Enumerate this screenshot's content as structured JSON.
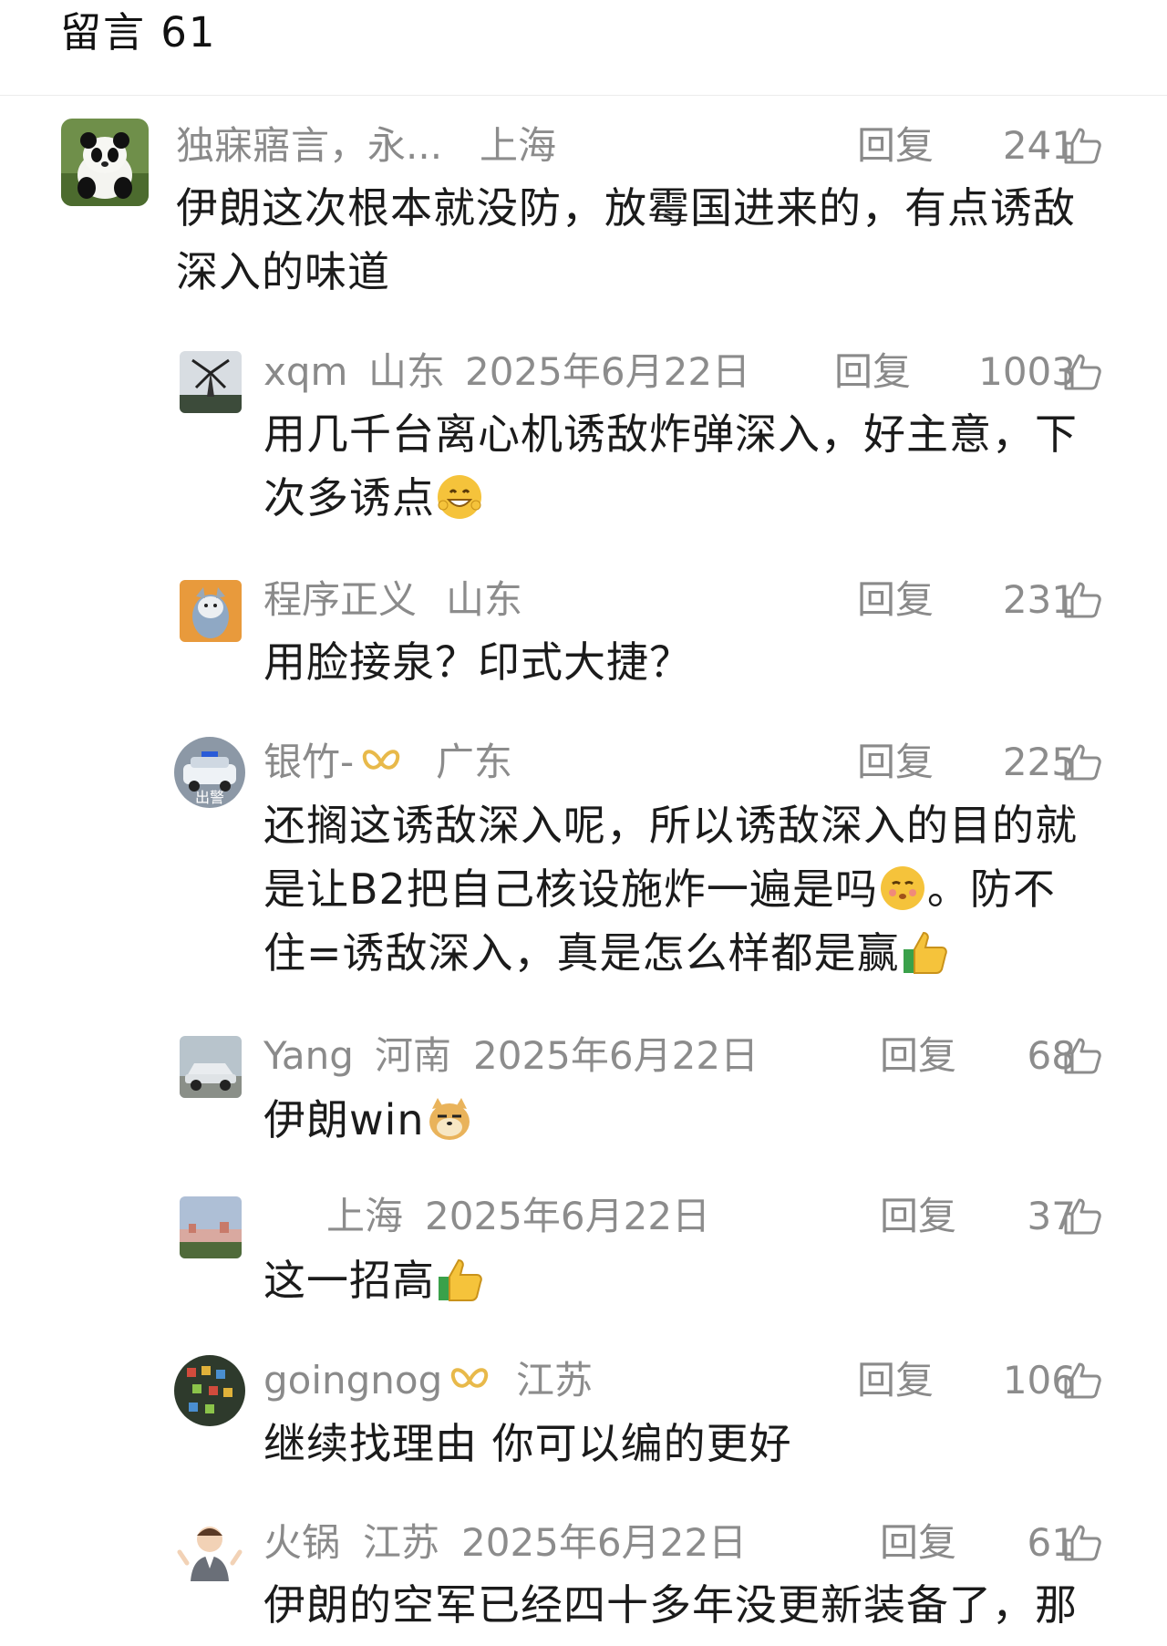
{
  "header": {
    "title": "留言 61"
  },
  "comments": [
    {
      "author": "独寐寤言，永...",
      "location": "上海",
      "date": "",
      "reply": "回复",
      "likes": "241",
      "text": [
        "伊朗这次根本就没防，放霉国进来的，有点诱敌",
        "深入的味道"
      ],
      "avatar": "panda-avatar"
    },
    {
      "author": "xqm",
      "location": "山东",
      "date": "2025年6月22日",
      "reply": "回复",
      "likes": "1003",
      "text": [
        "用几千台离心机诱敌炸弹深入，好主意，下",
        "次多诱点"
      ],
      "avatar": "windmill-avatar"
    },
    {
      "author": "程序正义",
      "location": "山东",
      "date": "",
      "reply": "回复",
      "likes": "231",
      "text": [
        "用脸接泉？印式大捷？"
      ],
      "avatar": "cartoon-avatar"
    },
    {
      "author": "银竹-",
      "location": "广东",
      "date": "",
      "reply": "回复",
      "likes": "225",
      "text": [
        "还搁这诱敌深入呢，所以诱敌深入的目的就",
        "是让B2把自己核设施炸一遍是吗",
        "住=诱敌深入，真是怎么样都是赢"
      ],
      "text_tail": "。防不",
      "avatar": "police-car-avatar",
      "avatar_label": "出警"
    },
    {
      "author": "Yang",
      "location": "河南",
      "date": "2025年6月22日",
      "reply": "回复",
      "likes": "68",
      "text": [
        "伊朗win"
      ],
      "avatar": "car-avatar"
    },
    {
      "author": "",
      "location": "上海",
      "date": "2025年6月22日",
      "reply": "回复",
      "likes": "37",
      "text": [
        "这一招高"
      ],
      "avatar": "landscape-avatar"
    },
    {
      "author": "goingnog",
      "location": "江苏",
      "date": "",
      "reply": "回复",
      "likes": "106",
      "text": [
        "继续找理由 你可以编的更好"
      ],
      "avatar": "game-avatar"
    },
    {
      "author": "火锅",
      "location": "江苏",
      "date": "2025年6月22日",
      "reply": "回复",
      "likes": "61",
      "text": [
        "伊朗的空军已经四十多年没更新装备了，那"
      ],
      "avatar": "person-avatar"
    }
  ],
  "icons": {
    "like": "thumbs-up-icon",
    "badge": "butterfly-badge-icon"
  },
  "colors": {
    "meta": "#8c8c8c",
    "text": "#1b1b1b",
    "badge": "#e8b94a"
  }
}
